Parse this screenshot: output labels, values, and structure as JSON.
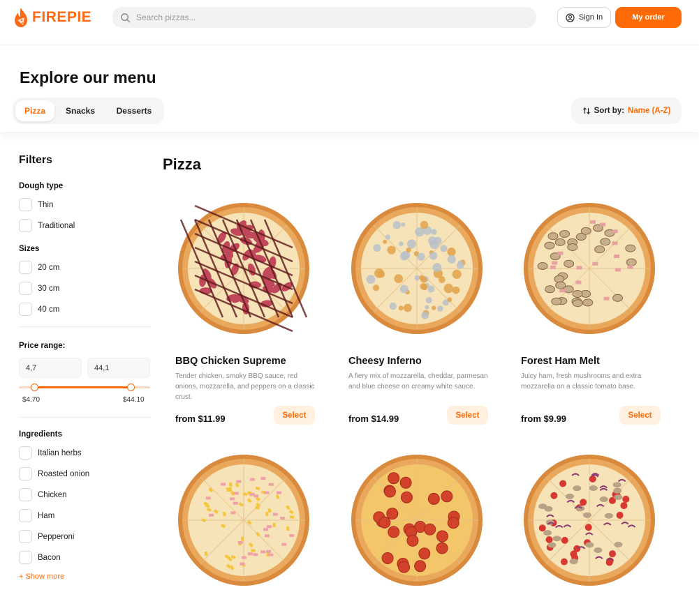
{
  "header": {
    "logo_text": "FIREPIE",
    "search_placeholder": "Search pizzas...",
    "signin_label": "Sign In",
    "myorder_label": "My order"
  },
  "menu": {
    "title": "Explore our menu",
    "tabs": [
      {
        "label": "Pizza",
        "active": true
      },
      {
        "label": "Snacks",
        "active": false
      },
      {
        "label": "Desserts",
        "active": false
      }
    ],
    "sort_label": "Sort by:",
    "sort_value": "Name (A-Z)"
  },
  "filters": {
    "title": "Filters",
    "dough": {
      "title": "Dough type",
      "options": [
        "Thin",
        "Traditional"
      ]
    },
    "sizes": {
      "title": "Sizes",
      "options": [
        "20 cm",
        "30 cm",
        "40 cm"
      ]
    },
    "price": {
      "title": "Price range:",
      "min_input": "4,7",
      "max_input": "44,1",
      "min_label": "$4.70",
      "max_label": "$44.10"
    },
    "ingredients": {
      "title": "Ingredients",
      "options": [
        "Italian herbs",
        "Roasted onion",
        "Chicken",
        "Ham",
        "Pepperoni",
        "Bacon"
      ],
      "show_more": "+ Show more"
    }
  },
  "section": {
    "title": "Pizza",
    "select_label": "Select",
    "products": [
      {
        "name": "BBQ Chicken Supreme",
        "desc": "Tender chicken, smoky BBQ sauce, red onions, mozzarella, and peppers on a classic crust.",
        "price": "from $11.99",
        "topping": "bbq"
      },
      {
        "name": "Cheesy Inferno",
        "desc": "A fiery mix of mozzarella, cheddar, parmesan and blue cheese on creamy white sauce.",
        "price": "from $14.99",
        "topping": "cheese"
      },
      {
        "name": "Forest Ham Melt",
        "desc": "Juicy ham, fresh mushrooms and extra mozzarella on a classic tomato base.",
        "price": "from $9.99",
        "topping": "mushroom"
      },
      {
        "topping": "hawaiian"
      },
      {
        "topping": "pepperoni"
      },
      {
        "topping": "veggie"
      }
    ]
  },
  "colors": {
    "accent": "#fe6b06",
    "accent_light": "#fff0e0",
    "crust": "#d98a3d",
    "cheese": "#f6e4b8"
  }
}
